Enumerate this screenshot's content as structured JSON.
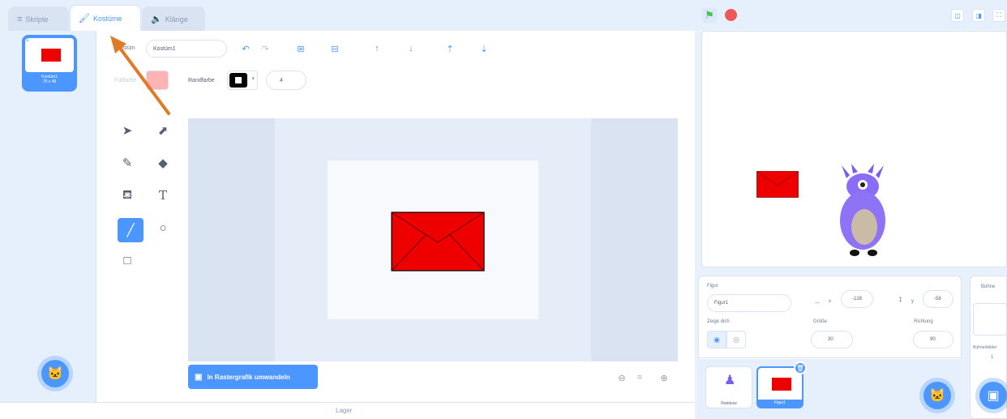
{
  "tabs": [
    {
      "label": "Skripte",
      "icon": "code-icon"
    },
    {
      "label": "Kostüme",
      "icon": "brush-icon"
    },
    {
      "label": "Klänge",
      "icon": "speaker-icon"
    }
  ],
  "costumes": {
    "items": [
      {
        "index": "1",
        "name": "Kostüm1",
        "size": "70 x 48"
      }
    ]
  },
  "editor": {
    "costume_label": "Kostüm",
    "costume_name": "Kostüm1",
    "fill_label": "Füllfarbe",
    "fill_color": "#ffb3b3",
    "outline_label": "Randfarbe",
    "outline_color": "#000000",
    "outline_width": "4",
    "convert_button": "In Rastergrafik umwandeln"
  },
  "stage": {
    "flag_color": "#4cbf56",
    "stop_color": "#ec5959"
  },
  "sprite_info": {
    "sprite_label": "Figur",
    "sprite_name": "Figur1",
    "x_label": "x",
    "x_value": "-128",
    "y_label": "y",
    "y_value": "-58",
    "show_label": "Zeige dich",
    "size_label": "Größe",
    "size_value": "30",
    "direction_label": "Richtung",
    "direction_value": "90"
  },
  "sprites": [
    {
      "name": "Rainbow"
    },
    {
      "name": "Figur1"
    }
  ],
  "backdrop_panel": {
    "title": "Bühne",
    "count_label": "Bühnenbilder",
    "count": "1"
  },
  "bottom": {
    "backpack_label": "Lager"
  },
  "colors": {
    "accent": "#4c97ff",
    "envelope": "#ee0000",
    "arrow": "#e07b25"
  }
}
